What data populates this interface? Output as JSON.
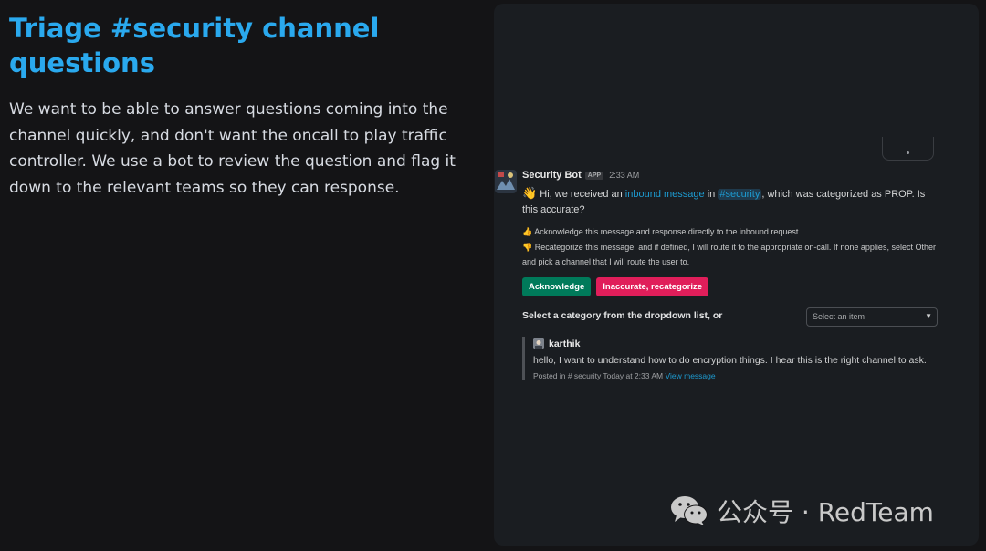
{
  "slide": {
    "title_line1": "Triage #security channel",
    "title_line2": "questions",
    "body": "We want to be able to answer questions coming into the channel quickly, and don't want the oncall to play traffic controller. We use a bot to review the question and flag it down to the relevant teams so they can response."
  },
  "message": {
    "sender": "Security Bot",
    "badge": "APP",
    "time": "2:33 AM",
    "wave_emoji": "👋",
    "text_prefix": " Hi, we received an ",
    "link_text": "inbound message",
    "text_in": " in ",
    "channel": "#security",
    "text_suffix": ", which was categorized as PROP. Is this accurate?",
    "ack_emoji": "👍",
    "ack_text": " Acknowledge this message and response directly to the inbound request.",
    "recat_emoji": "👎",
    "recat_text": " Recategorize this message, and if defined, I will route it to the appropriate on-call. If none applies, select Other and pick a channel that I will route the user to.",
    "buttons": {
      "acknowledge": "Acknowledge",
      "recategorize": "Inaccurate, recategorize"
    },
    "select_label": "Select a category from the dropdown list, or",
    "dropdown_placeholder": "Select an item"
  },
  "quote": {
    "author": "karthik",
    "text": "hello, I want to understand how to do encryption things. I hear this is the right channel to ask.",
    "posted_prefix": "Posted in",
    "channel": "# security",
    "time": "Today at 2:33 AM",
    "view_link": "View message"
  },
  "watermark": {
    "text": "公众号 · RedTeam"
  },
  "colors": {
    "title": "#2aa9ee",
    "acknowledge_button": "#007a5a",
    "recategorize_button": "#e01e5a",
    "link": "#1d9bd1"
  }
}
